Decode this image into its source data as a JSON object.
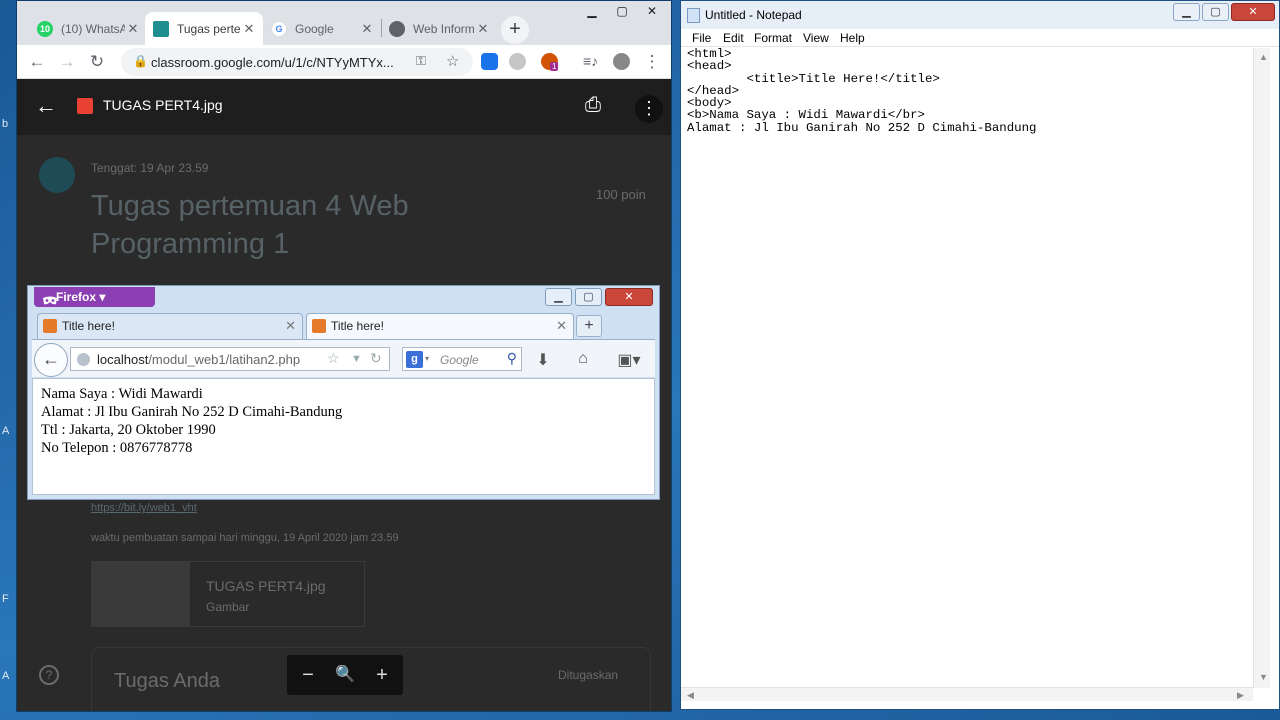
{
  "chrome": {
    "tabs": [
      {
        "label": "(10) WhatsA",
        "icon": "whatsapp-icon",
        "color": "#25d366",
        "badge": "10"
      },
      {
        "label": "Tugas perte",
        "icon": "classroom-icon",
        "color": "#1e8e8e",
        "badge": ""
      },
      {
        "label": "Google",
        "icon": "google-icon",
        "color": "#4285f4",
        "badge": "G"
      },
      {
        "label": "Web Inform",
        "icon": "globe-icon",
        "color": "#5f6368",
        "badge": ""
      }
    ],
    "url": "classroom.google.com/u/1/c/NTYyMTYx...",
    "ext_badge": "1"
  },
  "viewer": {
    "file_title": "TUGAS PERT4.jpg"
  },
  "classroom": {
    "due": "Tenggat: 19 Apr 23.59",
    "points": "100 poin",
    "title": "Tugas pertemuan 4 Web Programming 1",
    "link": "https://bit.ly/web1_vht",
    "description": "waktu pembuatan sampai hari minggu, 19 April 2020 jam 23.59",
    "attachment_name": "TUGAS PERT4.jpg",
    "attachment_type": "Gambar",
    "work_title": "Tugas Anda",
    "work_status": "Ditugaskan"
  },
  "firefox": {
    "app_button": "Firefox",
    "tabs": [
      "Title here!",
      "Title here!"
    ],
    "url_host": "localhost",
    "url_path": "/modul_web1/latihan2.php",
    "search_placeholder": "Google",
    "content_lines": [
      "Nama Saya : Widi Mawardi",
      "Alamat : Jl Ibu Ganirah No 252 D Cimahi-Bandung",
      "Ttl : Jakarta, 20 Oktober 1990",
      "No Telepon : 0876778778"
    ]
  },
  "notepad": {
    "title": "Untitled - Notepad",
    "menu": [
      "File",
      "Edit",
      "Format",
      "View",
      "Help"
    ],
    "lines": [
      "<html>",
      "<head>",
      "        <title>Title Here!</title>",
      "</head>",
      "<body>",
      "<b>Nama Saya : Widi Mawardi</br>",
      "Alamat : Jl Ibu Ganirah No 252 D Cimahi-Bandung"
    ]
  },
  "desktop": {
    "edge_letters": [
      "b",
      "A",
      "F",
      "A"
    ]
  }
}
